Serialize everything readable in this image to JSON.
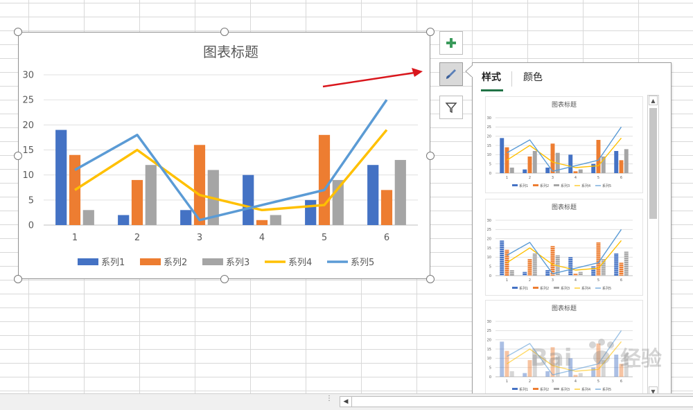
{
  "chart_data": {
    "type": "bar",
    "title": "图表标题",
    "categories": [
      "1",
      "2",
      "3",
      "4",
      "5",
      "6"
    ],
    "ylim": [
      0,
      30
    ],
    "yticks": [
      "0",
      "5",
      "10",
      "15",
      "20",
      "25",
      "30"
    ],
    "grid": true,
    "legend_position": "bottom",
    "series": [
      {
        "name": "系列1",
        "kind": "bar",
        "color": "#4472c4",
        "values": [
          19,
          2,
          3,
          10,
          5,
          12
        ]
      },
      {
        "name": "系列2",
        "kind": "bar",
        "color": "#ed7d31",
        "values": [
          14,
          9,
          16,
          1,
          18,
          7
        ]
      },
      {
        "name": "系列3",
        "kind": "bar",
        "color": "#a5a5a5",
        "values": [
          3,
          12,
          11,
          2,
          9,
          13
        ]
      },
      {
        "name": "系列4",
        "kind": "line",
        "color": "#ffc000",
        "values": [
          7,
          15,
          6,
          3,
          4,
          19
        ]
      },
      {
        "name": "系列5",
        "kind": "line",
        "color": "#5b9bd5",
        "values": [
          11,
          18,
          1,
          4,
          7,
          25
        ]
      }
    ]
  },
  "side_buttons": {
    "add_icon": "plus-icon",
    "style_icon": "brush-icon",
    "filter_icon": "filter-icon"
  },
  "style_pane": {
    "tab_style": "样式",
    "tab_color": "颜色",
    "thumb_title": "图表标题"
  },
  "watermark": "Baidu 经验",
  "colors": {
    "excel_green": "#217346",
    "arrow_red": "#d9161c"
  }
}
